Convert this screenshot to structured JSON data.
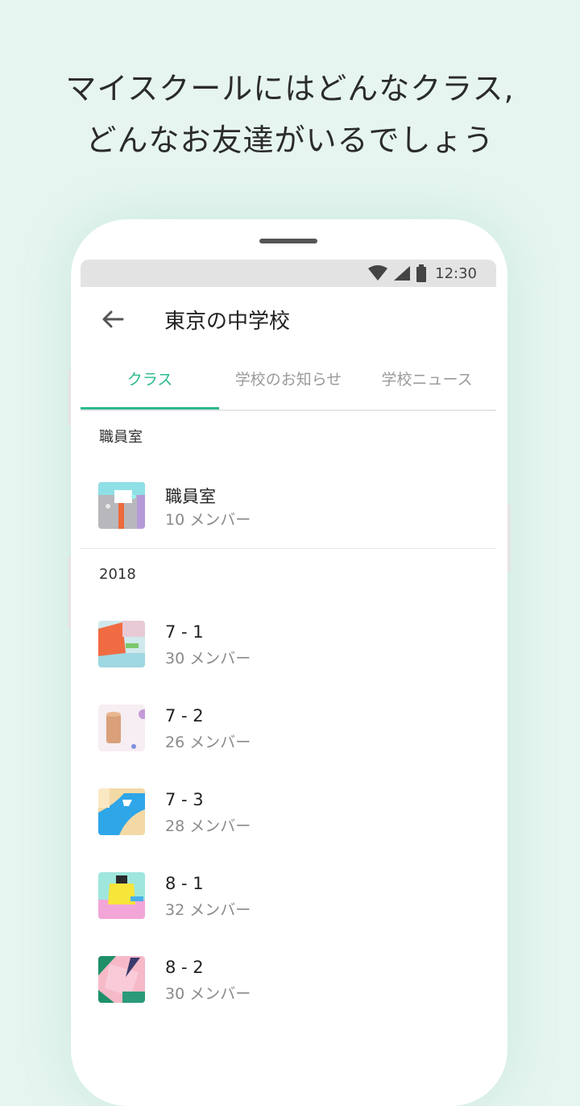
{
  "headline": {
    "line1": "マイスクールにはどんなクラス,",
    "line2": "どんなお友達がいるでしょう"
  },
  "status_bar": {
    "time": "12:30",
    "icons": [
      "wifi-icon",
      "signal-icon",
      "battery-icon"
    ]
  },
  "app_bar": {
    "back_icon": "back-arrow-icon",
    "title": "東京の中学校"
  },
  "tabs": [
    {
      "label": "クラス",
      "active": true
    },
    {
      "label": "学校のお知らせ",
      "active": false
    },
    {
      "label": "学校ニュース",
      "active": false
    }
  ],
  "sections": [
    {
      "label": "職員室",
      "items": [
        {
          "title": "職員室",
          "members": "10 メンバー"
        }
      ]
    },
    {
      "label": "2018",
      "items": [
        {
          "title": "7 - 1",
          "members": "30 メンバー"
        },
        {
          "title": "7 - 2",
          "members": "26 メンバー"
        },
        {
          "title": "7 - 3",
          "members": "28 メンバー"
        },
        {
          "title": "8 - 1",
          "members": "32 メンバー"
        },
        {
          "title": "8 - 2",
          "members": "30 メンバー"
        }
      ]
    }
  ],
  "colors": {
    "accent": "#2ab98f",
    "background": "#e6f5f0"
  }
}
